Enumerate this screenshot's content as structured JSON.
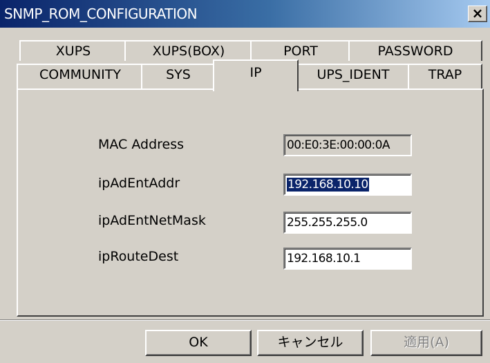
{
  "window": {
    "title": "SNMP_ROM_CONFIGURATION",
    "close_label": "×"
  },
  "tabs": {
    "row1": [
      {
        "label": "XUPS"
      },
      {
        "label": "XUPS(BOX)"
      },
      {
        "label": "PORT"
      },
      {
        "label": "PASSWORD"
      }
    ],
    "row2": [
      {
        "label": "COMMUNITY"
      },
      {
        "label": "SYS"
      },
      {
        "label": "IP",
        "active": true
      },
      {
        "label": "UPS_IDENT"
      },
      {
        "label": "TRAP"
      }
    ]
  },
  "ip_panel": {
    "mac_label": "MAC Address",
    "mac_value": "00:E0:3E:00:00:0A",
    "addr_label": "ipAdEntAddr",
    "addr_value": "192.168.10.10",
    "mask_label": "ipAdEntNetMask",
    "mask_value": "255.255.255.0",
    "route_label": "ipRouteDest",
    "route_value": "192.168.10.1"
  },
  "buttons": {
    "ok": "OK",
    "cancel": "キャンセル",
    "apply": "適用(A)"
  }
}
